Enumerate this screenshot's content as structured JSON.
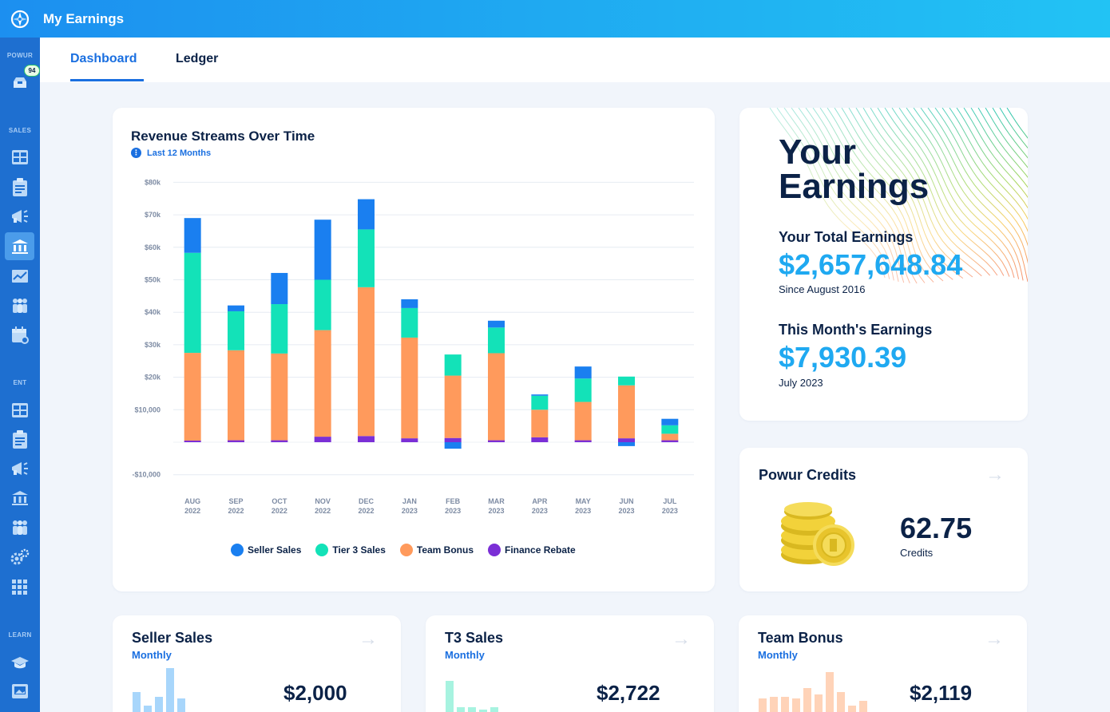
{
  "header": {
    "title": "My Earnings",
    "logo_icon": "compass-icon"
  },
  "sidebar": {
    "sections": [
      {
        "label": "POWUR"
      },
      {
        "label": "SALES"
      },
      {
        "label": "ENT"
      },
      {
        "label": "LEARN"
      }
    ],
    "inbox_badge": "94"
  },
  "tabs": [
    {
      "label": "Dashboard",
      "active": true
    },
    {
      "label": "Ledger",
      "active": false
    }
  ],
  "revenue": {
    "title": "Revenue Streams Over Time",
    "range_label": "Last 12 Months"
  },
  "chart_data": {
    "type": "bar",
    "stacked": true,
    "title": "Revenue Streams Over Time",
    "categories": [
      "AUG\n2022",
      "SEP\n2022",
      "OCT\n2022",
      "NOV\n2022",
      "DEC\n2022",
      "JAN\n2023",
      "FEB\n2023",
      "MAR\n2023",
      "APR\n2023",
      "MAY\n2023",
      "JUN\n2023",
      "JUL\n2023"
    ],
    "category_lines": [
      [
        "AUG",
        "2022"
      ],
      [
        "SEP",
        "2022"
      ],
      [
        "OCT",
        "2022"
      ],
      [
        "NOV",
        "2022"
      ],
      [
        "DEC",
        "2022"
      ],
      [
        "JAN",
        "2023"
      ],
      [
        "FEB",
        "2023"
      ],
      [
        "MAR",
        "2023"
      ],
      [
        "APR",
        "2023"
      ],
      [
        "MAY",
        "2023"
      ],
      [
        "JUN",
        "2023"
      ],
      [
        "JUL",
        "2023"
      ]
    ],
    "ytick_labels": [
      "$80k",
      "$70k",
      "$60k",
      "$50k",
      "$40k",
      "$30k",
      "$20k",
      "$10,000",
      "-$10,000"
    ],
    "ytick_values": [
      80000,
      70000,
      60000,
      50000,
      40000,
      30000,
      20000,
      10000,
      -10000
    ],
    "ylim": [
      -10000,
      80000
    ],
    "legend_position": "bottom",
    "series": [
      {
        "name": "Finance Rebate",
        "color": "#7b2fd6",
        "values": [
          500,
          600,
          600,
          1700,
          1900,
          1200,
          1300,
          600,
          1500,
          600,
          1200,
          600
        ]
      },
      {
        "name": "Team Bonus",
        "color": "#ff9a5c",
        "values": [
          27000,
          27700,
          26700,
          32800,
          45800,
          31000,
          19200,
          26800,
          8500,
          11800,
          16300,
          2000
        ]
      },
      {
        "name": "Tier 3 Sales",
        "color": "#13e2b8",
        "values": [
          30800,
          12000,
          15200,
          15500,
          17800,
          9100,
          6500,
          7900,
          4300,
          7200,
          2700,
          2600
        ]
      },
      {
        "name": "Seller Sales",
        "color": "#1a7ff0",
        "values": [
          10700,
          1800,
          9600,
          18500,
          9300,
          2700,
          0,
          2100,
          400,
          3700,
          0,
          2000
        ]
      },
      {
        "name": "Seller Sales (negative)",
        "color": "#1a7ff0",
        "values": [
          0,
          0,
          0,
          0,
          0,
          0,
          -2000,
          0,
          0,
          0,
          -1200,
          0
        ]
      }
    ],
    "legend": [
      {
        "name": "Seller Sales",
        "color": "#1a7ff0"
      },
      {
        "name": "Tier 3 Sales",
        "color": "#13e2b8"
      },
      {
        "name": "Team Bonus",
        "color": "#ff9a5c"
      },
      {
        "name": "Finance Rebate",
        "color": "#7b2fd6"
      }
    ]
  },
  "earnings": {
    "title_line1": "Your",
    "title_line2": "Earnings",
    "total_label": "Your Total Earnings",
    "total_amount": "$2,657,648.84",
    "total_since": "Since August 2016",
    "month_label": "This Month's Earnings",
    "month_amount": "$7,930.39",
    "month_period": "July 2023"
  },
  "credits": {
    "title": "Powur Credits",
    "value": "62.75",
    "unit": "Credits"
  },
  "summary_cards": [
    {
      "title": "Seller Sales",
      "sub": "Monthly",
      "value": "$2,000",
      "color": "#a8d6fb",
      "bars": [
        0.45,
        0.15,
        0.35,
        1.0,
        0.3
      ]
    },
    {
      "title": "T3 Sales",
      "sub": "Monthly",
      "value": "$2,722",
      "color": "#a7f3e0",
      "bars": [
        0.7,
        0.1,
        0.1,
        0.05,
        0.1
      ]
    },
    {
      "title": "Team Bonus",
      "sub": "Monthly",
      "value": "$2,119",
      "color": "#ffd3b8",
      "bars": [
        0.3,
        0.35,
        0.35,
        0.3,
        0.55,
        0.4,
        0.9,
        0.45,
        0.15,
        0.25
      ]
    }
  ]
}
